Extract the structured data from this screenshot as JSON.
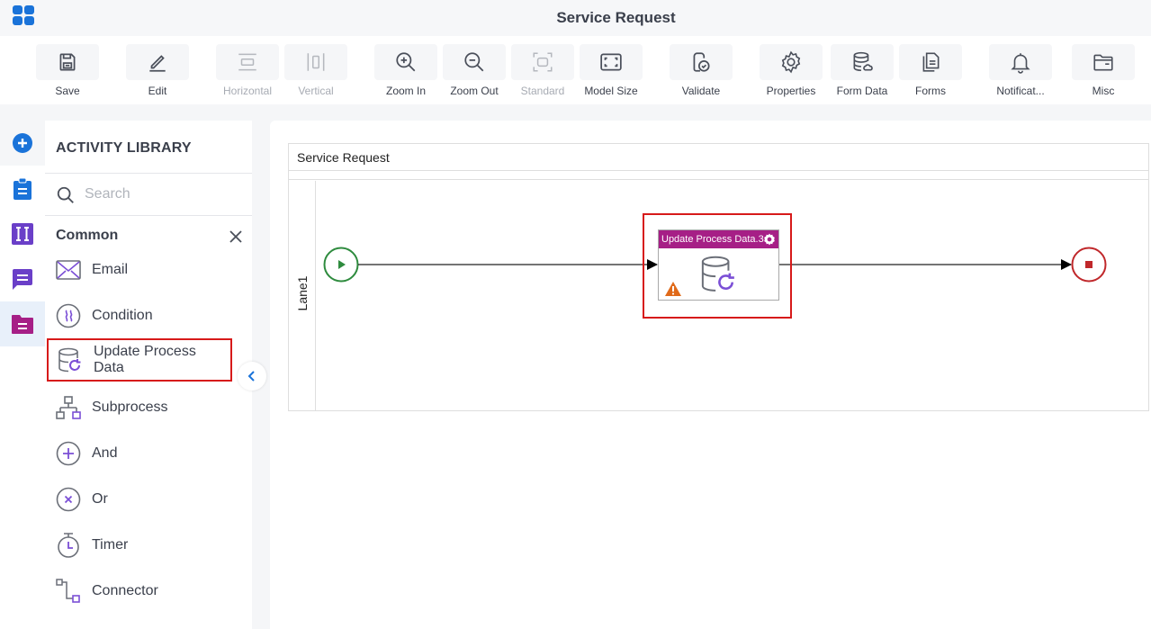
{
  "window": {
    "title": "Service Request"
  },
  "toolbar": {
    "buttons": [
      {
        "id": "save",
        "label": "Save",
        "icon": "save-icon",
        "disabled": false
      },
      {
        "id": "edit",
        "label": "Edit",
        "icon": "edit-icon",
        "disabled": false
      },
      {
        "id": "horizontal",
        "label": "Horizontal",
        "icon": "horizontal-icon",
        "disabled": true
      },
      {
        "id": "vertical",
        "label": "Vertical",
        "icon": "vertical-icon",
        "disabled": true
      },
      {
        "id": "zoom_in",
        "label": "Zoom In",
        "icon": "zoom-in-icon",
        "disabled": false
      },
      {
        "id": "zoom_out",
        "label": "Zoom Out",
        "icon": "zoom-out-icon",
        "disabled": false
      },
      {
        "id": "standard",
        "label": "Standard",
        "icon": "standard-icon",
        "disabled": true
      },
      {
        "id": "model_size",
        "label": "Model Size",
        "icon": "model-size-icon",
        "disabled": false
      },
      {
        "id": "validate",
        "label": "Validate",
        "icon": "validate-icon",
        "disabled": false
      },
      {
        "id": "properties",
        "label": "Properties",
        "icon": "gear-icon",
        "disabled": false
      },
      {
        "id": "form_data",
        "label": "Form Data",
        "icon": "database-icon",
        "disabled": false
      },
      {
        "id": "forms",
        "label": "Forms",
        "icon": "forms-icon",
        "disabled": false
      },
      {
        "id": "notifications",
        "label": "Notificat...",
        "icon": "bell-icon",
        "disabled": false
      },
      {
        "id": "misc",
        "label": "Misc",
        "icon": "folder-icon",
        "disabled": false
      }
    ]
  },
  "left_rail": {
    "items": [
      {
        "icon": "add-circle-icon",
        "color": "#1a73d9"
      },
      {
        "icon": "clipboard-icon",
        "color": "#1a73d9"
      },
      {
        "icon": "text-field-icon",
        "color": "#6a3fc8"
      },
      {
        "icon": "comment-icon",
        "color": "#6a3fc8"
      },
      {
        "icon": "folder-doc-icon",
        "color": "#a61f86",
        "active": true
      }
    ]
  },
  "library": {
    "title": "ACTIVITY LIBRARY",
    "search_placeholder": "Search",
    "search_value": "",
    "category": "Common",
    "items": [
      {
        "label": "Email",
        "icon": "email-icon"
      },
      {
        "label": "Condition",
        "icon": "condition-icon"
      },
      {
        "label": "Update Process Data",
        "icon": "update-process-data-icon",
        "highlighted": true
      },
      {
        "label": "Subprocess",
        "icon": "subprocess-icon"
      },
      {
        "label": "And",
        "icon": "and-gateway-icon"
      },
      {
        "label": "Or",
        "icon": "or-gateway-icon"
      },
      {
        "label": "Timer",
        "icon": "timer-icon"
      },
      {
        "label": "Connector",
        "icon": "connector-icon"
      }
    ]
  },
  "canvas": {
    "pool_title": "Service Request",
    "lane_label": "Lane1",
    "task": {
      "title": "Update Process Data.3",
      "has_warning": true,
      "header_color": "#a61f86"
    },
    "start_event_color": "#2e8b3e",
    "end_event_color": "#c0282b"
  }
}
